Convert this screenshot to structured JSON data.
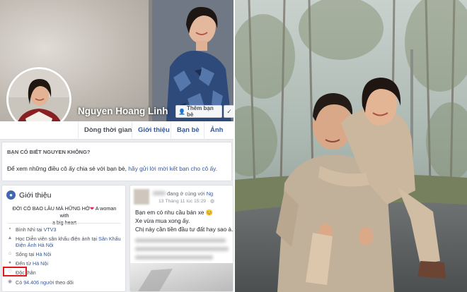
{
  "profile": {
    "name": "Nguyen Hoang Linh",
    "add_friend_label": "Thêm bạn bè",
    "check_icon": "✓"
  },
  "tabs": [
    {
      "label": "Dòng thời gian"
    },
    {
      "label": "Giới thiệu"
    },
    {
      "label": "Bạn bè"
    },
    {
      "label": "Ảnh"
    }
  ],
  "know_card": {
    "title": "BẠN CÓ BIẾT NGUYEN KHÔNG?",
    "text_prefix": "Để xem những điều cô ấy chia sẻ với bạn bè, ",
    "text_link": "hãy gửi lời mời kết bạn cho cô ấy."
  },
  "intro": {
    "title": "Giới thiệu",
    "bio_line1": "ĐỜI CÓ BAO LÂU MÀ HỮNG HỜ",
    "bio_heart": "❤",
    "bio_line1_tail": " A woman with",
    "bio_line2": "a big heart",
    "items": [
      {
        "icon": "briefcase-icon",
        "prefix": "Bình Nhì tại ",
        "link": "VTV3",
        "suffix": ""
      },
      {
        "icon": "graduation-cap-icon",
        "prefix": "Học Diễn viên sân khấu điện ảnh tại ",
        "link": "Sân Khấu",
        "suffix": "",
        "line2_link": "Điện Ảnh Hà Nội"
      },
      {
        "icon": "home-icon",
        "prefix": "Sống tại ",
        "link": "Hà Nội",
        "suffix": ""
      },
      {
        "icon": "location-pin-icon",
        "prefix": "Đến từ ",
        "link": "Hà Nội",
        "suffix": ""
      },
      {
        "icon": "heart-icon",
        "prefix": "Độc thân",
        "link": "",
        "suffix": ""
      },
      {
        "icon": "follower-icon",
        "prefix": "Có ",
        "link": "94.406 người",
        "suffix": " theo dõi"
      }
    ]
  },
  "post": {
    "header_text": "đang ở cùng với ",
    "header_link": "Ng",
    "time": "13 Tháng 11 lúc 15:29 · ",
    "lines": [
      "Bạn em có nhu cầu bán xe 😊",
      "Xe vừa mua xong ấy.",
      "Chị này cần tiền đầu tư đất hay sao à. Hi"
    ]
  },
  "colors": {
    "facebook_blue": "#365899",
    "highlight_red": "#e0181c",
    "page_bg": "#e9ebee"
  }
}
